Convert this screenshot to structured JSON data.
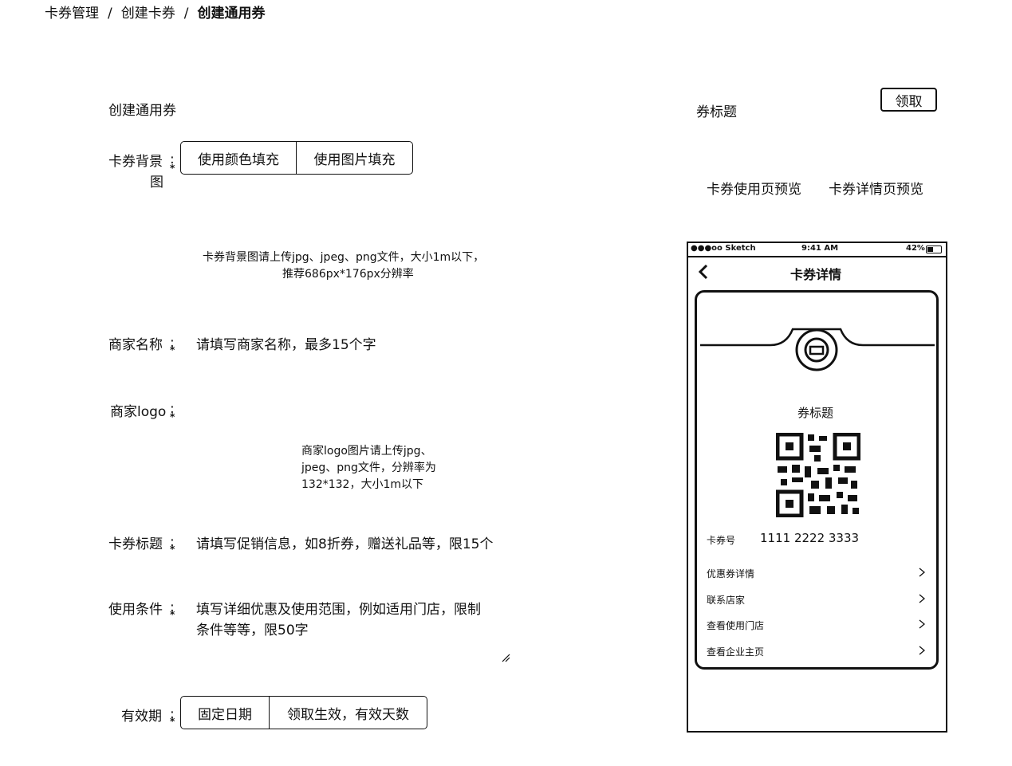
{
  "breadcrumb": {
    "items": [
      "卡券管理",
      "创建卡券",
      "创建通用券"
    ],
    "separator": "/"
  },
  "form": {
    "section_title": "创建通用券",
    "background": {
      "label": "卡券背景",
      "label_line2": "图",
      "options": [
        "使用颜色填充",
        "使用图片填充"
      ],
      "hint_line1": "卡券背景图请上传jpg、jpeg、png文件，大小1m以下，",
      "hint_line2": "推荐686px*176px分辨率"
    },
    "merchant_name": {
      "label": "商家名称",
      "placeholder": "请填写商家名称，最多15个字"
    },
    "merchant_logo": {
      "label": "商家logo",
      "hint_line1": "商家logo图片请上传jpg、",
      "hint_line2": "jpeg、png文件，分辨率为",
      "hint_line3": "132*132，大小1m以下"
    },
    "title": {
      "label": "卡券标题",
      "placeholder": "请填写促销信息，如8折券，赠送礼品等，限15个"
    },
    "conditions": {
      "label": "使用条件",
      "placeholder_line1": "填写详细优惠及使用范围，例如适用门店，限制",
      "placeholder_line2": "条件等等，限50字"
    },
    "validity": {
      "label": "有效期",
      "options": [
        "固定日期",
        "领取生效，有效天数"
      ]
    },
    "required_mark": "*",
    "colon": ":"
  },
  "preview": {
    "header_text": "券标题",
    "get_button": "领取",
    "tabs": [
      "卡券使用页预览",
      "卡券详情页预览"
    ],
    "phone": {
      "carrier": "●●●oo Sketch",
      "time": "9:41 AM",
      "battery": "42%",
      "nav_title": "卡券详情",
      "coupon_title": "券标题",
      "number_label": "卡券号",
      "number_value": "1111 2222 3333",
      "menu": [
        "优惠券详情",
        "联系店家",
        "查看使用门店",
        "查看企业主页"
      ]
    }
  }
}
